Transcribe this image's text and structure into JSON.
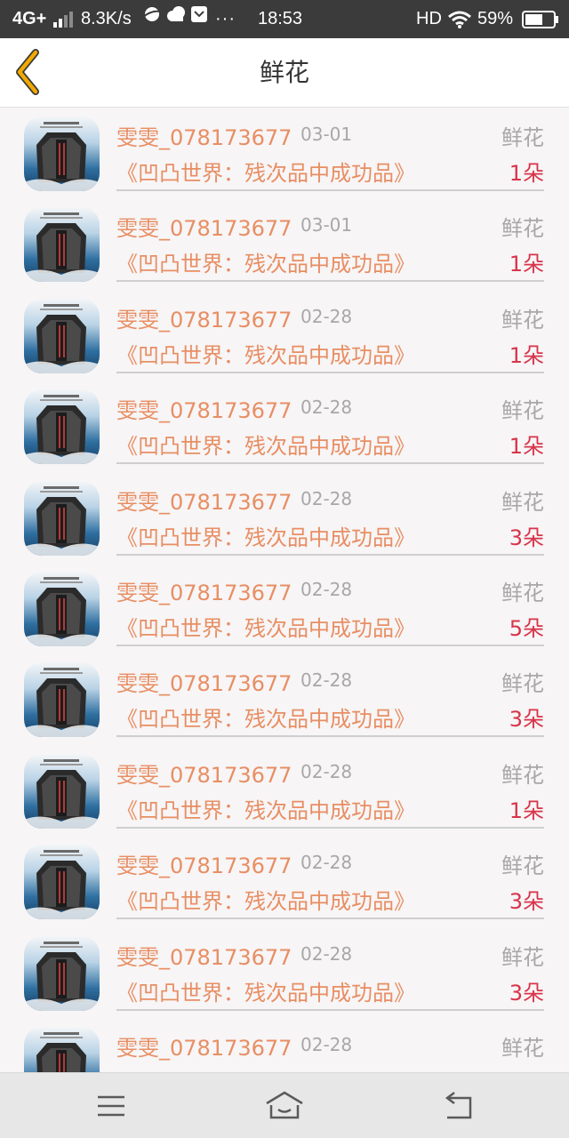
{
  "status_bar": {
    "network": "4G+",
    "speed": "8.3K/s",
    "more": "···",
    "time": "18:53",
    "hd": "HD",
    "battery": "59%",
    "icons": [
      "signal-icon",
      "planet-icon",
      "cloud-icon",
      "message-icon",
      "wifi-icon",
      "battery-icon"
    ]
  },
  "header": {
    "title": "鲜花",
    "back_icon": "chevron-left-icon",
    "accent_color": "#f2a900"
  },
  "list": {
    "items": [
      {
        "user": "雯雯_078173677",
        "date": "03-01",
        "type": "鲜花",
        "book": "《凹凸世界：残次品中成功品》",
        "count": "1朵"
      },
      {
        "user": "雯雯_078173677",
        "date": "03-01",
        "type": "鲜花",
        "book": "《凹凸世界：残次品中成功品》",
        "count": "1朵"
      },
      {
        "user": "雯雯_078173677",
        "date": "02-28",
        "type": "鲜花",
        "book": "《凹凸世界：残次品中成功品》",
        "count": "1朵"
      },
      {
        "user": "雯雯_078173677",
        "date": "02-28",
        "type": "鲜花",
        "book": "《凹凸世界：残次品中成功品》",
        "count": "1朵"
      },
      {
        "user": "雯雯_078173677",
        "date": "02-28",
        "type": "鲜花",
        "book": "《凹凸世界：残次品中成功品》",
        "count": "3朵"
      },
      {
        "user": "雯雯_078173677",
        "date": "02-28",
        "type": "鲜花",
        "book": "《凹凸世界：残次品中成功品》",
        "count": "5朵"
      },
      {
        "user": "雯雯_078173677",
        "date": "02-28",
        "type": "鲜花",
        "book": "《凹凸世界：残次品中成功品》",
        "count": "3朵"
      },
      {
        "user": "雯雯_078173677",
        "date": "02-28",
        "type": "鲜花",
        "book": "《凹凸世界：残次品中成功品》",
        "count": "1朵"
      },
      {
        "user": "雯雯_078173677",
        "date": "02-28",
        "type": "鲜花",
        "book": "《凹凸世界：残次品中成功品》",
        "count": "3朵"
      },
      {
        "user": "雯雯_078173677",
        "date": "02-28",
        "type": "鲜花",
        "book": "《凹凸世界：残次品中成功品》",
        "count": "3朵"
      },
      {
        "user": "雯雯_078173677",
        "date": "02-28",
        "type": "鲜花",
        "book": "",
        "count": ""
      }
    ]
  },
  "colors": {
    "name": "#e88e63",
    "count": "#d8344a",
    "muted": "#a8a8a8"
  },
  "nav": {
    "icons": [
      "menu-icon",
      "home-icon",
      "return-icon"
    ]
  }
}
